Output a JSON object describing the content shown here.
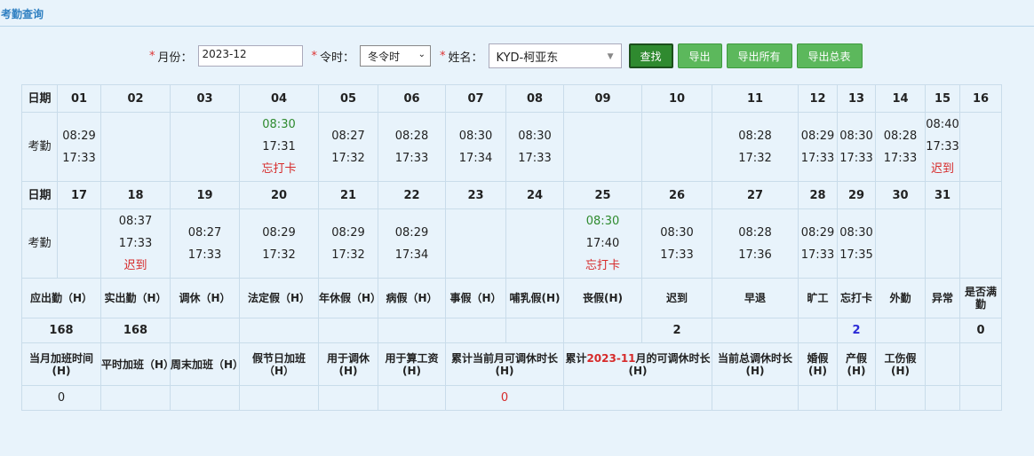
{
  "title": "考勤查询",
  "filters": {
    "month_label": "月份：",
    "month_value": "2023-12",
    "season_label": "令时：",
    "season_value": "冬令时",
    "name_label": "姓名：",
    "name_value": "KYD-柯亚东"
  },
  "buttons": [
    "查找",
    "导出",
    "导出所有",
    "导出总表"
  ],
  "row_date_label": "日期",
  "row_att_label": "考勤",
  "week1_days": [
    "01",
    "02",
    "03",
    "04",
    "05",
    "06",
    "07",
    "08",
    "09",
    "10",
    "11",
    "12",
    "13",
    "14",
    "15",
    "16"
  ],
  "week1_att": [
    {
      "lines": [
        {
          "t": "08:29"
        },
        {
          "t": "17:33"
        }
      ]
    },
    {
      "lines": []
    },
    {
      "lines": []
    },
    {
      "lines": [
        {
          "t": "08:30",
          "c": "green"
        },
        {
          "t": "17:31"
        },
        {
          "t": "忘打卡",
          "c": "red"
        }
      ]
    },
    {
      "lines": [
        {
          "t": "08:27"
        },
        {
          "t": "17:32"
        }
      ]
    },
    {
      "lines": [
        {
          "t": "08:28"
        },
        {
          "t": "17:33"
        }
      ]
    },
    {
      "lines": [
        {
          "t": "08:30"
        },
        {
          "t": "17:34"
        }
      ]
    },
    {
      "lines": [
        {
          "t": "08:30"
        },
        {
          "t": "17:33"
        }
      ]
    },
    {
      "lines": []
    },
    {
      "lines": []
    },
    {
      "lines": [
        {
          "t": "08:28"
        },
        {
          "t": "17:32"
        }
      ]
    },
    {
      "lines": [
        {
          "t": "08:29"
        },
        {
          "t": "17:33"
        }
      ]
    },
    {
      "lines": [
        {
          "t": "08:30"
        },
        {
          "t": "17:33"
        }
      ]
    },
    {
      "lines": [
        {
          "t": "08:28"
        },
        {
          "t": "17:33"
        }
      ]
    },
    {
      "lines": [
        {
          "t": "08:40"
        },
        {
          "t": "17:33"
        },
        {
          "t": "迟到",
          "c": "red"
        }
      ]
    },
    {
      "lines": []
    }
  ],
  "week2_days": [
    "17",
    "18",
    "19",
    "20",
    "21",
    "22",
    "23",
    "24",
    "25",
    "26",
    "27",
    "28",
    "29",
    "30",
    "31",
    ""
  ],
  "week2_att": [
    {
      "lines": []
    },
    {
      "lines": [
        {
          "t": "08:37"
        },
        {
          "t": "17:33"
        },
        {
          "t": "迟到",
          "c": "red"
        }
      ]
    },
    {
      "lines": [
        {
          "t": "08:27"
        },
        {
          "t": "17:33"
        }
      ]
    },
    {
      "lines": [
        {
          "t": "08:29"
        },
        {
          "t": "17:32"
        }
      ]
    },
    {
      "lines": [
        {
          "t": "08:29"
        },
        {
          "t": "17:32"
        }
      ]
    },
    {
      "lines": [
        {
          "t": "08:29"
        },
        {
          "t": "17:34"
        }
      ]
    },
    {
      "lines": []
    },
    {
      "lines": []
    },
    {
      "lines": [
        {
          "t": "08:30",
          "c": "green"
        },
        {
          "t": "17:40"
        },
        {
          "t": "忘打卡",
          "c": "red"
        }
      ]
    },
    {
      "lines": [
        {
          "t": "08:30"
        },
        {
          "t": "17:33"
        }
      ]
    },
    {
      "lines": [
        {
          "t": "08:28"
        },
        {
          "t": "17:36"
        }
      ]
    },
    {
      "lines": [
        {
          "t": "08:29"
        },
        {
          "t": "17:33"
        }
      ]
    },
    {
      "lines": [
        {
          "t": "08:30"
        },
        {
          "t": "17:35"
        }
      ]
    },
    {
      "lines": []
    },
    {
      "lines": []
    },
    {
      "lines": []
    }
  ],
  "summary_headers": [
    "应出勤（H）",
    "实出勤（H）",
    "调休（H）",
    "法定假（H）",
    "年休假（H）",
    "病假（H）",
    "事假（H）",
    "哺乳假(H)",
    "丧假(H)",
    "迟到",
    "早退",
    "旷工",
    "忘打卡",
    "外勤",
    "异常",
    "是否满勤"
  ],
  "summary_values": [
    {
      "t": "168"
    },
    {
      "t": "168"
    },
    {
      "t": ""
    },
    {
      "t": ""
    },
    {
      "t": ""
    },
    {
      "t": ""
    },
    {
      "t": ""
    },
    {
      "t": ""
    },
    {
      "t": ""
    },
    {
      "t": "2"
    },
    {
      "t": ""
    },
    {
      "t": ""
    },
    {
      "t": "2",
      "c": "blue"
    },
    {
      "t": ""
    },
    {
      "t": ""
    },
    {
      "t": "0"
    }
  ],
  "overtime_headers": {
    "monthly_ot": "当月加班时间(H)",
    "weekday_ot": "平时加班（H）",
    "weekend_ot": "周末加班（H）",
    "holiday_ot": "假节日加班（H）",
    "for_comp": "用于调休(H)",
    "for_wage": "用于算工资(H)",
    "cum_current": "累计当前月可调休时长(H)",
    "cum_prev_prefix": "累计",
    "cum_prev_month": "2023-11",
    "cum_prev_suffix": "月的可调休时长(H)",
    "total_comp": "当前总调休时长(H)",
    "marriage": "婚假(H)",
    "maternity": "产假(H)",
    "injury": "工伤假(H)"
  },
  "overtime_values": {
    "monthly_ot": "0",
    "cum_current": "0"
  }
}
